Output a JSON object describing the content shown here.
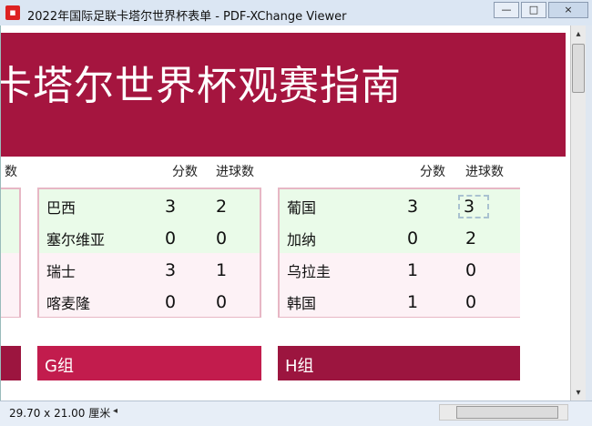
{
  "window": {
    "title": "2022年国际足联卡塔尔世界杯表单 - PDF-XChange Viewer",
    "app_icon": "pdf-icon",
    "controls": [
      "minimize",
      "maximize",
      "close"
    ],
    "control_glyphs": [
      "—",
      "□",
      "×"
    ]
  },
  "document": {
    "banner_title": "卡塔尔世界杯观赛指南",
    "left_column_header": "数",
    "middle": {
      "header_points": "分数",
      "header_goals": "进球数",
      "rows": [
        {
          "team": "巴西",
          "points": "3",
          "goals": "2"
        },
        {
          "team": "塞尔维亚",
          "points": "0",
          "goals": "0"
        },
        {
          "team": "瑞士",
          "points": "3",
          "goals": "1"
        },
        {
          "team": "喀麦隆",
          "points": "0",
          "goals": "0"
        }
      ]
    },
    "right": {
      "header_points": "分数",
      "header_goals": "进球数",
      "rows": [
        {
          "team": "葡国",
          "points": "3",
          "goals": "3"
        },
        {
          "team": "加纳",
          "points": "0",
          "goals": "2"
        },
        {
          "team": "乌拉圭",
          "points": "1",
          "goals": "0"
        },
        {
          "team": "韩国",
          "points": "1",
          "goals": "0"
        }
      ]
    },
    "group_g": "G组",
    "group_h": "H组"
  },
  "status": {
    "page_size": "29.70 x 21.00 厘米",
    "scroll_left_glyph": "◂",
    "scroll_right_glyph": "▸",
    "scroll_up_glyph": "▴",
    "scroll_down_glyph": "▾"
  },
  "colors": {
    "banner": "#a5153f",
    "group_header": "#c21c4d",
    "group_header_dark": "#9c153f",
    "row_green": "#eafbe9",
    "row_pink": "#fdf2f6",
    "table_border": "#e7b7c5"
  }
}
